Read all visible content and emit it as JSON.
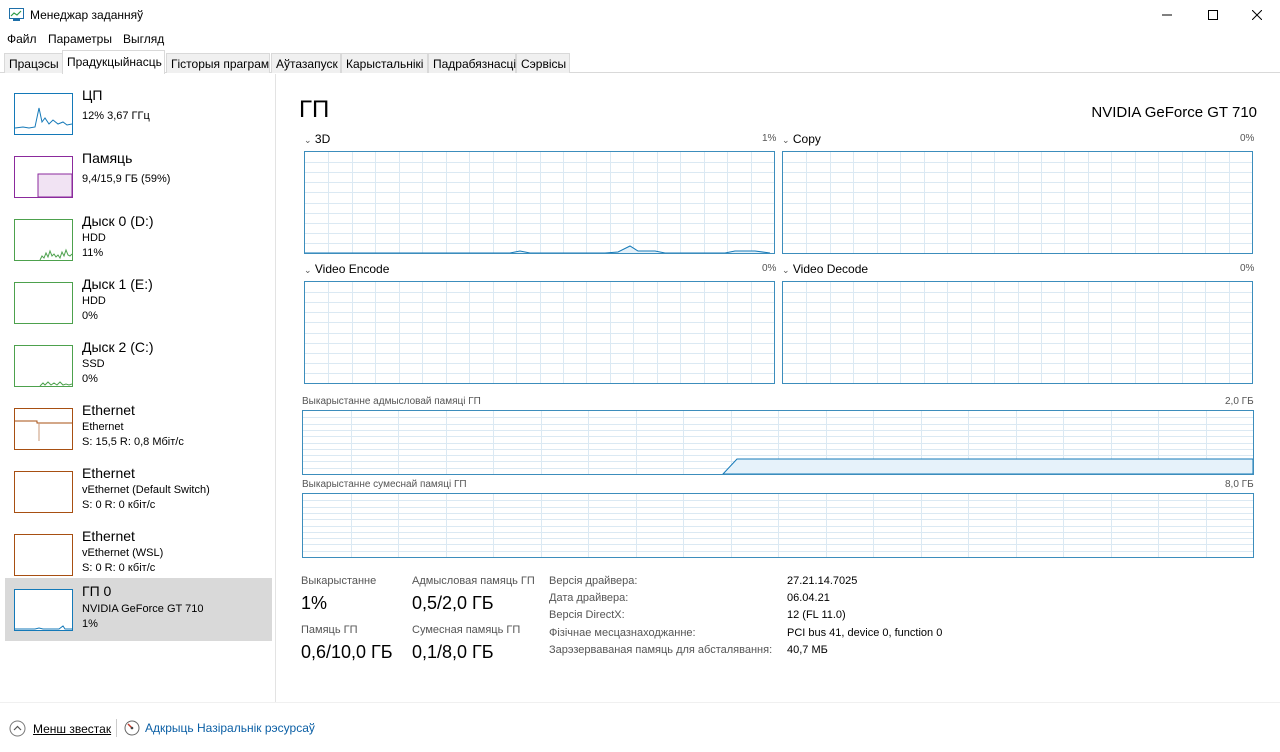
{
  "window": {
    "title": "Менеджар заданняў",
    "icons": [
      "app-icon",
      "minimize-icon",
      "maximize-icon",
      "close-icon"
    ]
  },
  "menu": [
    "Файл",
    "Параметры",
    "Выгляд"
  ],
  "tabs": [
    "Працэсы",
    "Прадукцыйнасць",
    "Гісторыя праграм",
    "Аўтазапуск",
    "Карыстальнікі",
    "Падрабязнасці",
    "Сэрвісы"
  ],
  "active_tab": "Прадукцыйнасць",
  "sidebar": [
    {
      "name": "ЦП",
      "sub1": "12% 3,67 ГГц",
      "color": "#1479b8"
    },
    {
      "name": "Памяць",
      "sub1": "9,4/15,9 ГБ (59%)",
      "color": "#8b2a9c"
    },
    {
      "name": "Дыск 0 (D:)",
      "sub1": "HDD",
      "sub2": "11%",
      "color": "#4da14d"
    },
    {
      "name": "Дыск 1 (E:)",
      "sub1": "HDD",
      "sub2": "0%",
      "color": "#4da14d"
    },
    {
      "name": "Дыск 2 (C:)",
      "sub1": "SSD",
      "sub2": "0%",
      "color": "#4da14d"
    },
    {
      "name": "Ethernet",
      "sub1": "Ethernet",
      "sub2": "S: 15,5 R: 0,8 Мбіт/с",
      "color": "#a74f12"
    },
    {
      "name": "Ethernet",
      "sub1": "vEthernet (Default Switch)",
      "sub2": "S: 0 R: 0 кбіт/с",
      "color": "#a74f12"
    },
    {
      "name": "Ethernet",
      "sub1": "vEthernet (WSL)",
      "sub2": "S: 0 R: 0 кбіт/с",
      "color": "#a74f12"
    },
    {
      "name": "ГП 0",
      "sub1": "NVIDIA GeForce GT 710",
      "sub2": "1%",
      "color": "#1479b8"
    }
  ],
  "gpu": {
    "title": "ГП",
    "model": "NVIDIA GeForce GT 710",
    "engines": [
      {
        "name": "3D",
        "pct": "1%"
      },
      {
        "name": "Copy",
        "pct": "0%"
      },
      {
        "name": "Video Encode",
        "pct": "0%"
      },
      {
        "name": "Video Decode",
        "pct": "0%"
      }
    ],
    "dedicated": {
      "label": "Выкарыстанне адмысловай памяці ГП",
      "max": "2,0 ГБ"
    },
    "shared": {
      "label": "Выкарыстанне сумеснай памяці ГП",
      "max": "8,0 ГБ"
    },
    "stats": [
      {
        "label": "Выкарыстанне",
        "value": "1%"
      },
      {
        "label": "Адмысловая памяць ГП",
        "value": "0,5/2,0 ГБ"
      },
      {
        "label": "Памяць ГП",
        "value": "0,6/10,0 ГБ"
      },
      {
        "label": "Сумесная памяць ГП",
        "value": "0,1/8,0 ГБ"
      }
    ],
    "info": [
      {
        "label": "Версія драйвера:",
        "value": "27.21.14.7025"
      },
      {
        "label": "Дата драйвера:",
        "value": "06.04.21"
      },
      {
        "label": "Версія DirectX:",
        "value": "12 (FL 11.0)"
      },
      {
        "label": "Фізічнае месцазнаходжанне:",
        "value": "PCI bus 41, device 0, function 0"
      },
      {
        "label": "Зарэзерваваная памяць для абсталявання:",
        "value": "40,7 МБ"
      }
    ]
  },
  "footer": {
    "less_details": "Менш звестак",
    "resource_monitor": "Адкрыць Назіральнік рэсурсаў"
  }
}
